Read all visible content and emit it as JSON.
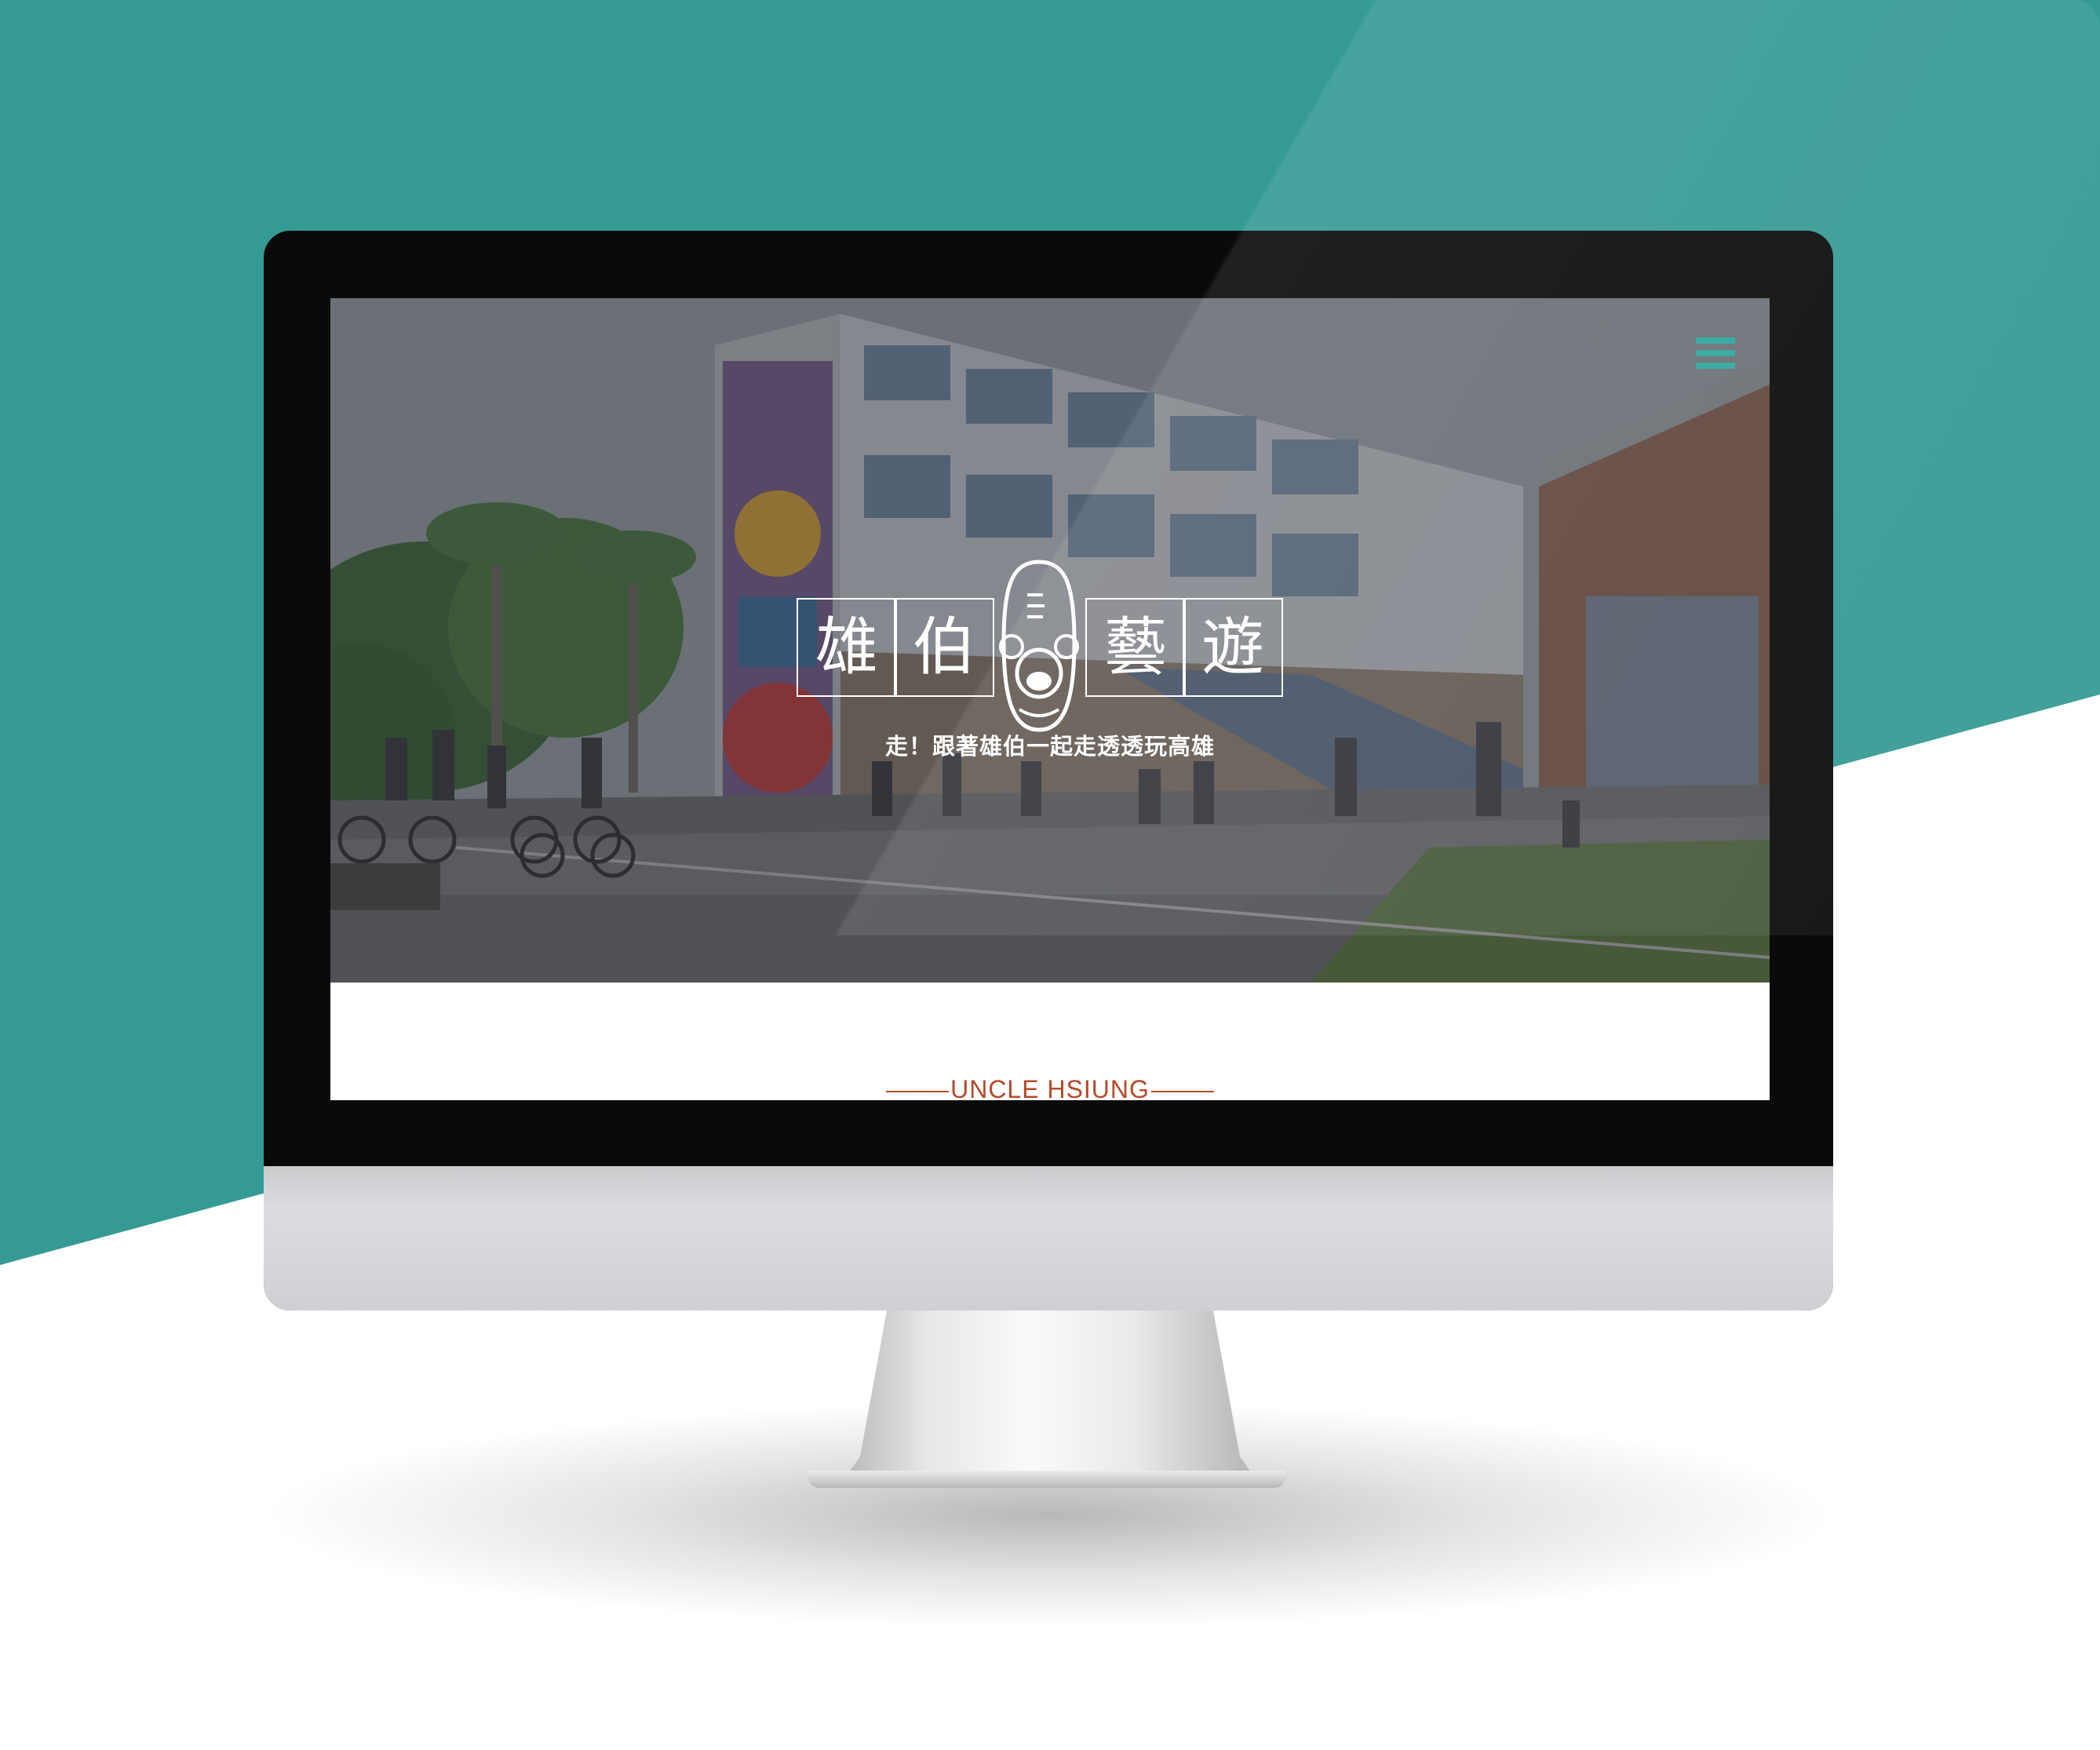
{
  "hero": {
    "logo_chars": [
      "雄",
      "伯",
      "藝",
      "遊"
    ],
    "tagline": "走！跟著雄伯一起走透透玩高雄"
  },
  "nav": {
    "menu_icon": "hamburger-menu-icon"
  },
  "section": {
    "heading": "UNCLE HSIUNG"
  },
  "colors": {
    "teal_background": "#359a94",
    "accent_teal": "#2ea59c",
    "heading_rust": "#b54a2a"
  }
}
